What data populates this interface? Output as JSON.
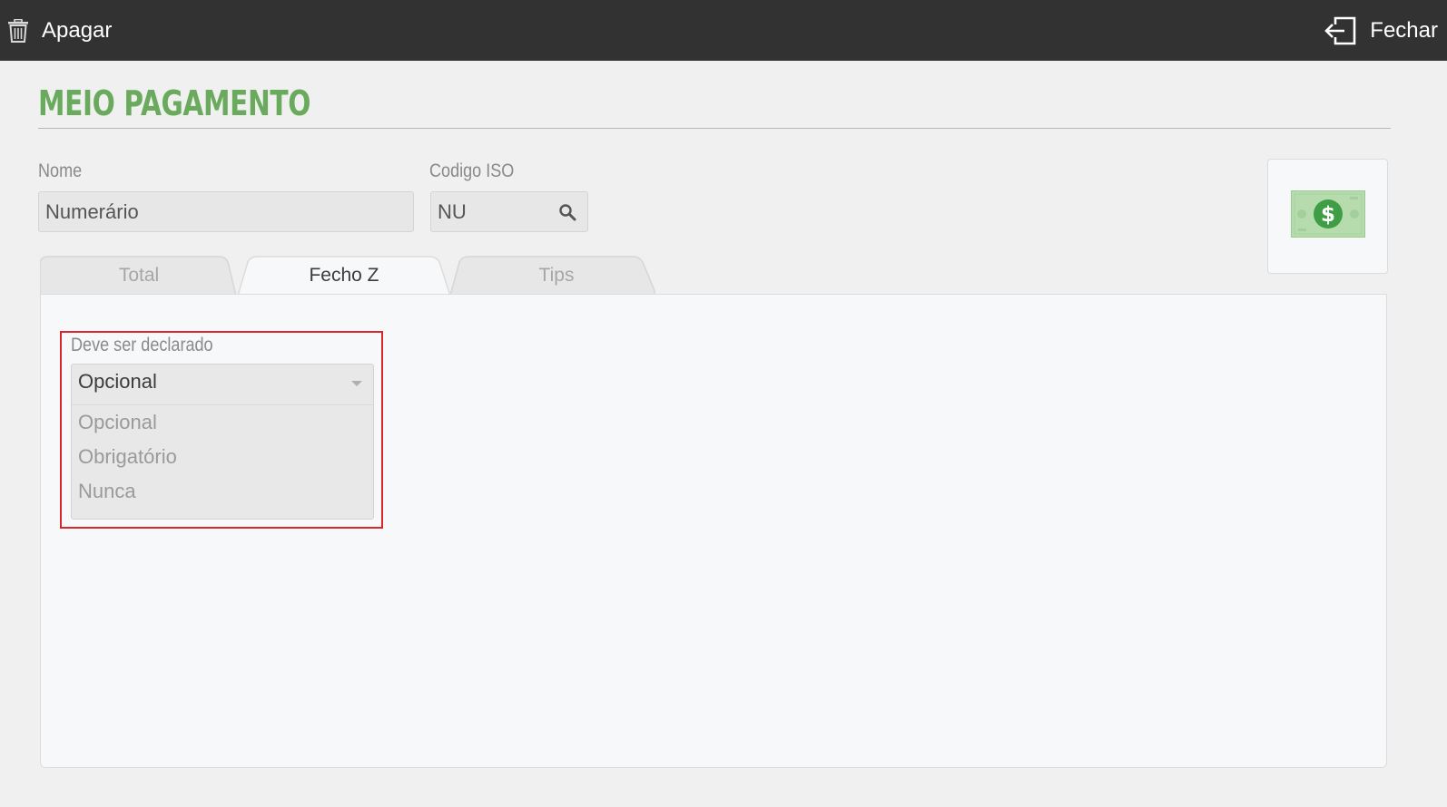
{
  "toolbar": {
    "delete_label": "Apagar",
    "close_label": "Fechar",
    "delete_icon": "trash-icon",
    "close_icon": "exit-icon"
  },
  "page": {
    "title": "MEIO PAGAMENTO"
  },
  "form": {
    "name_label": "Nome",
    "name_value": "Numerário",
    "iso_label": "Codigo ISO",
    "iso_value": "NU",
    "iso_icon": "search-icon",
    "image_icon": "banknote-dollar-icon"
  },
  "tabs": [
    {
      "label": "Total",
      "active": false
    },
    {
      "label": "Fecho Z",
      "active": true
    },
    {
      "label": "Tips",
      "active": false
    }
  ],
  "fecho_z": {
    "declare_label": "Deve ser declarado",
    "declare_selected": "Opcional",
    "declare_options": [
      "Opcional",
      "Obrigatório",
      "Nunca"
    ]
  },
  "colors": {
    "topbar": "#323232",
    "title_green": "#6aaa5c",
    "highlight_red": "#d9252b",
    "note_green": "#4caf50"
  }
}
